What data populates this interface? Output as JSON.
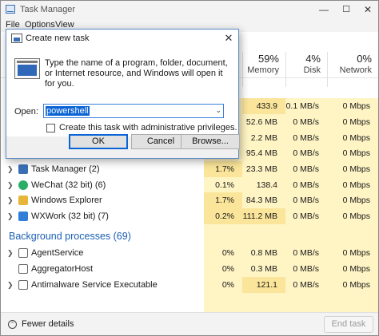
{
  "window": {
    "title": "Task Manager",
    "minimize": "—",
    "maximize": "☐",
    "close": "✕"
  },
  "menu": [
    "File",
    "Options",
    "View"
  ],
  "columns": [
    {
      "pct": "59%",
      "name": "Memory"
    },
    {
      "pct": "4%",
      "name": "Disk"
    },
    {
      "pct": "0%",
      "name": "Network"
    }
  ],
  "hidden_rows": [
    {
      "mem": "433.9 MB",
      "disk": "0.1 MB/s",
      "net": "0 Mbps"
    },
    {
      "mem": "52.6 MB",
      "disk": "0 MB/s",
      "net": "0 Mbps"
    },
    {
      "mem": "2.2 MB",
      "disk": "0 MB/s",
      "net": "0 Mbps"
    },
    {
      "mem": "95.4 MB",
      "disk": "0 MB/s",
      "net": "0 Mbps"
    },
    {
      "mem": "14.7 MB",
      "disk": "0 MB/s",
      "net": "0 Mbps"
    }
  ],
  "apps": [
    {
      "name": "Task Manager (2)",
      "cpu": "1.7%",
      "mem": "23.3 MB",
      "disk": "0 MB/s",
      "net": "0 Mbps",
      "icon_color": "#3a6fb5",
      "icon": "task-manager-icon"
    },
    {
      "name": "WeChat (32 bit) (6)",
      "cpu": "0.1%",
      "mem": "138.4 MB",
      "disk": "0 MB/s",
      "net": "0 Mbps",
      "icon_color": "#2aae67",
      "icon": "wechat-icon"
    },
    {
      "name": "Windows Explorer",
      "cpu": "1.7%",
      "mem": "84.3 MB",
      "disk": "0 MB/s",
      "net": "0 Mbps",
      "icon_color": "#e6b53a",
      "icon": "folder-icon"
    },
    {
      "name": "WXWork (32 bit) (7)",
      "cpu": "0.2%",
      "mem": "111.2 MB",
      "disk": "0 MB/s",
      "net": "0 Mbps",
      "icon_color": "#2f7fd8",
      "icon": "wxwork-icon"
    }
  ],
  "background_section": "Background processes (69)",
  "background": [
    {
      "name": "AgentService",
      "cpu": "0%",
      "mem": "0.8 MB",
      "disk": "0 MB/s",
      "net": "0 Mbps"
    },
    {
      "name": "AggregatorHost",
      "cpu": "0%",
      "mem": "0.3 MB",
      "disk": "0 MB/s",
      "net": "0 Mbps"
    },
    {
      "name": "Antimalware Service Executable",
      "cpu": "0%",
      "mem": "121.1 MB",
      "disk": "0 MB/s",
      "net": "0 Mbps"
    }
  ],
  "status": {
    "fewer_details": "Fewer details",
    "end_task": "End task"
  },
  "dialog": {
    "title": "Create new task",
    "close": "✕",
    "prompt": "Type the name of a program, folder, document, or Internet resource, and Windows will open it for you.",
    "open_label": "Open:",
    "open_value": "powershell",
    "admin_label": "Create this task with administrative privileges.",
    "ok": "OK",
    "cancel": "Cancel",
    "browse": "Browse..."
  }
}
